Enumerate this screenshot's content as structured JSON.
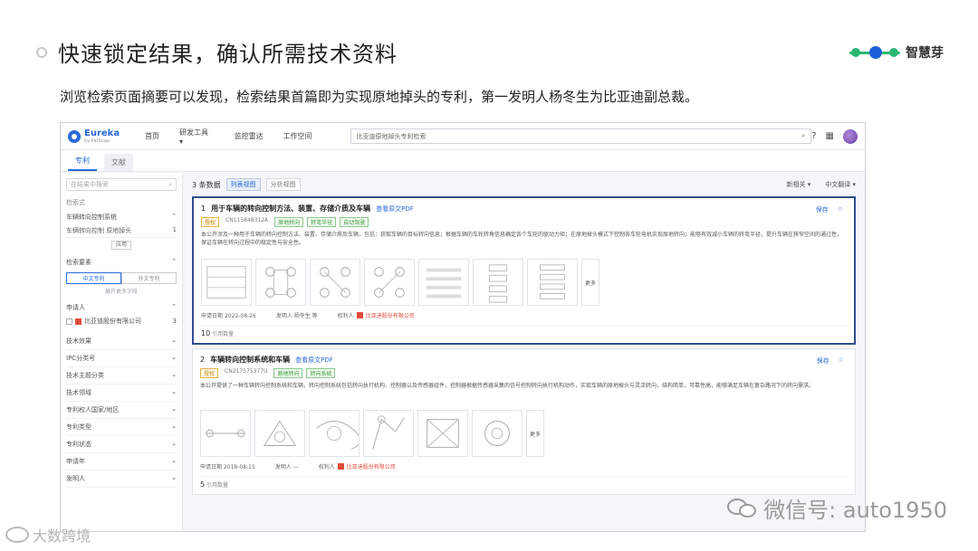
{
  "slide": {
    "title": "快速锁定结果，确认所需技术资料",
    "subtitle": "浏览检索页面摘要可以发现，检索结果首篇即为实现原地掉头的专利，第一发明人杨冬生为比亚迪副总裁。",
    "brand": "智慧芽"
  },
  "app": {
    "name": "Eureka",
    "tagline": "by PatSnap",
    "nav": [
      "首页",
      "研发工具 ▾",
      "监控雷达",
      "工作空间"
    ],
    "search_query": "比亚迪原地掉头专利检索",
    "tabs": [
      "专利",
      "文献"
    ]
  },
  "sidebar": {
    "search_placeholder": "在结果中搜索",
    "section1_title": "检索式",
    "section1_sub": "车辆转向控制系统",
    "query_line": "车辆转向控制 原地掉头",
    "query_count": "1",
    "apply_label": "应用",
    "section2_title": "检索要素",
    "seg_on": "中文专利",
    "seg_off": "外文专利",
    "expand_link": "展开更多字段",
    "assignee_title": "申请人",
    "assignee_name": "比亚迪股份有限公司",
    "assignee_count": "3",
    "filters": [
      "技术效果",
      "IPC分类号",
      "技术主题分类",
      "技术领域",
      "专利权人国家/地区",
      "专利类型",
      "专利状态",
      "申请年",
      "发明人"
    ]
  },
  "results": {
    "count_label": "3 条数据",
    "view_list": "列表视图",
    "view_analysis": "分析视图",
    "sort_label": "新相关 ▾",
    "lang_label": "中文翻译 ▾",
    "items": [
      {
        "index": "1",
        "title": "用于车辆的转向控制方法、装置、存储介质及车辆",
        "pdf_link": "查看原文PDF",
        "tags": [
          {
            "text": "授权",
            "style": "y"
          },
          {
            "text": "CN115848312A",
            "style": "n"
          },
          {
            "text": "原地转向",
            "style": "g"
          },
          {
            "text": "转弯半径",
            "style": "g"
          },
          {
            "text": "自动驾驶",
            "style": "g"
          }
        ],
        "abstract": "本公开涉及一种用于车辆的转向控制方法、装置、存储介质及车辆，包括：获取车辆的目标转向信息；根据车辆的车轮转角信息确定各个车轮的驱动力矩；在原地掉头模式下控制各车轮电机实现原地转向；能够有效减小车辆的转弯半径，提升车辆在狭窄空间的通过性，保证车辆在转向过程中的稳定性与安全性。",
        "filed_label": "申请日期",
        "filed": "2022-08-26",
        "inventor_label": "发明人",
        "inventor": "杨冬生 等",
        "owner_label": "权利人",
        "owner": "比亚迪股份有限公司",
        "cite_count": "10",
        "cite_label": "引用数量",
        "more_label": "更多",
        "actions": [
          "保存",
          "☆"
        ]
      },
      {
        "index": "2",
        "title": "车辆转向控制系统和车辆",
        "pdf_link": "查看原文PDF",
        "tags": [
          {
            "text": "授权",
            "style": "y"
          },
          {
            "text": "CN217575377U",
            "style": "n"
          },
          {
            "text": "原地转向",
            "style": "g"
          },
          {
            "text": "转向系统",
            "style": "g"
          }
        ],
        "abstract": "本公开提供了一种车辆转向控制系统和车辆，转向控制系统包括转向执行机构、控制器以及传感器组件，控制器根据传感器采集的信号控制转向执行机构动作，实现车辆的原地掉头与灵活转向，结构简单，可靠性高，能够满足车辆在复杂路况下的转向需求。",
        "filed_label": "申请日期",
        "filed": "2018-08-15",
        "inventor_label": "发明人",
        "inventor": "—",
        "owner_label": "权利人",
        "owner": "比亚迪股份有限公司",
        "cite_count": "5",
        "cite_label": "引用数量",
        "more_label": "更多",
        "actions": [
          "保存",
          "☆"
        ]
      }
    ]
  },
  "watermarks": {
    "wechat": "微信号: auto1950",
    "corner": "大数跨境"
  }
}
